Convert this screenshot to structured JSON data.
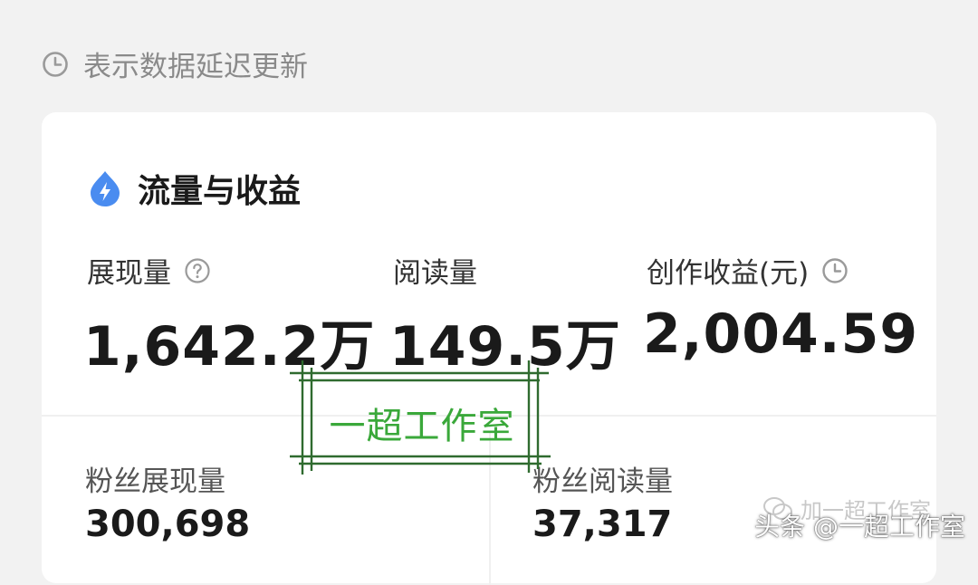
{
  "notice": {
    "icon": "clock-icon",
    "text": "表示数据延迟更新"
  },
  "card": {
    "title": "流量与收益",
    "title_icon": "lightning-drop-icon",
    "accent_color": "#4a8cf0",
    "metrics": [
      {
        "label": "展现量",
        "value": "1,642.2万",
        "icon": "help-circle-icon"
      },
      {
        "label": "阅读量",
        "value": "149.5万"
      },
      {
        "label": "创作收益(元)",
        "value": "2,004.59",
        "icon": "clock-icon"
      }
    ],
    "sub_metrics": [
      {
        "label": "粉丝展现量",
        "value": "300,698"
      },
      {
        "label": "粉丝阅读量",
        "value": "37,317"
      }
    ]
  },
  "watermark": {
    "stamp_text": "一超工作室",
    "stamp_color": "#3aa83a",
    "follow_text": "加一超工作室",
    "source_text": "头条 @一超工作室"
  }
}
